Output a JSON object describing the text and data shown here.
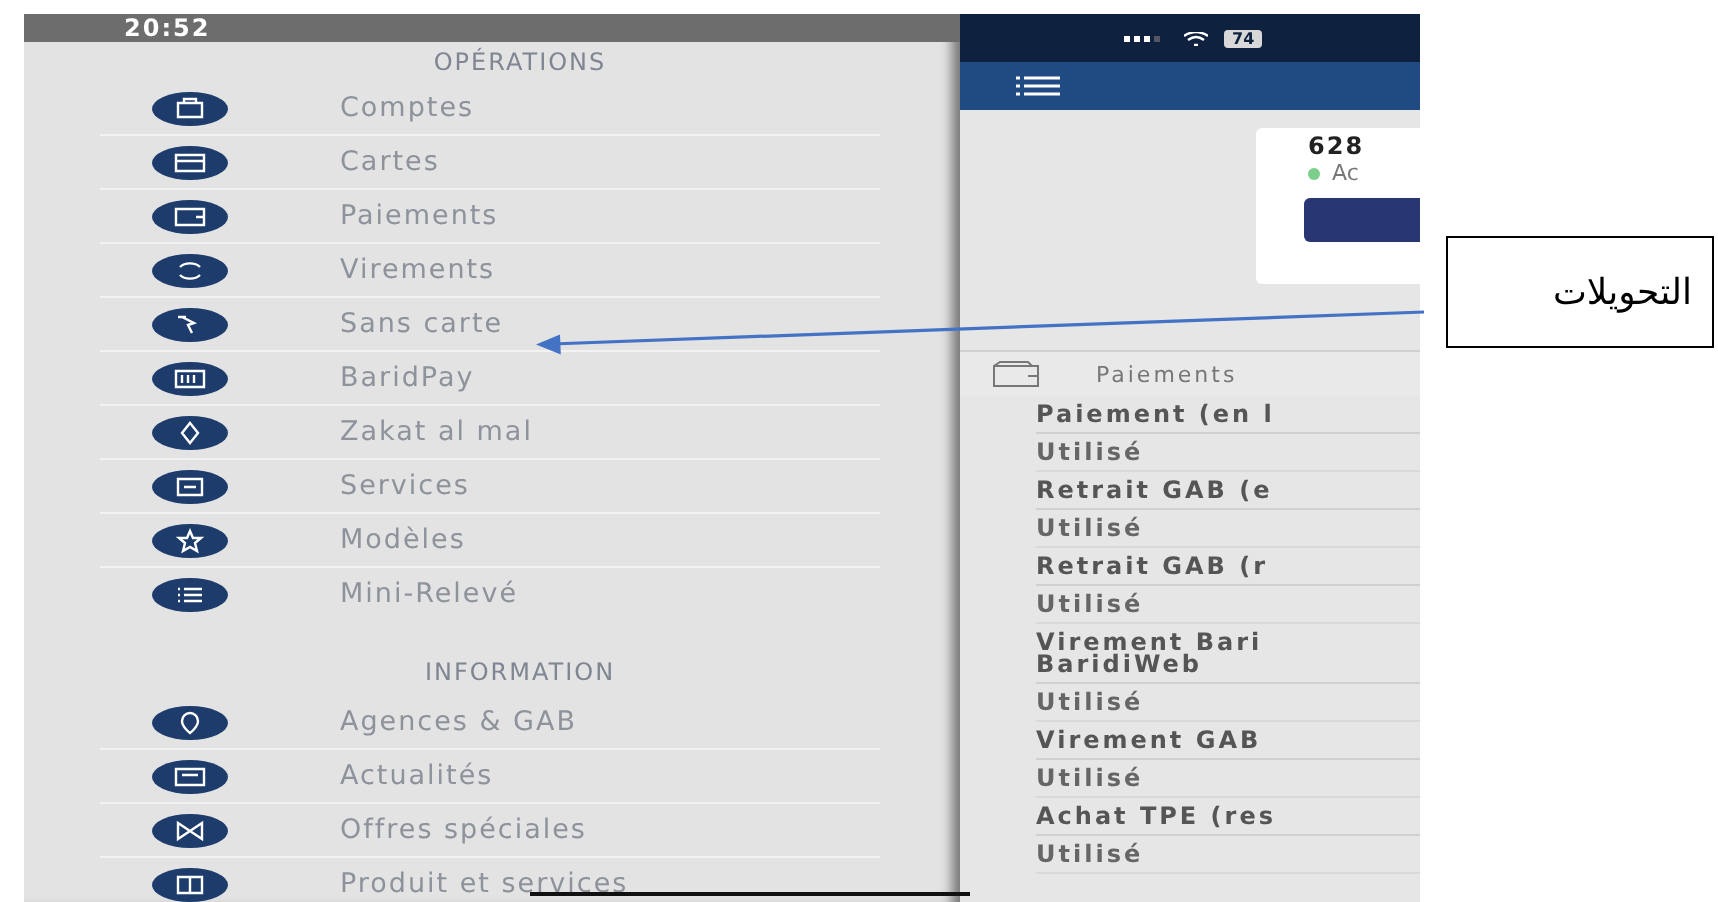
{
  "status_bar": {
    "time": "20:52",
    "battery": "74"
  },
  "drawer": {
    "sections": [
      {
        "title": "OPÉRATIONS",
        "items": [
          {
            "label": "Comptes"
          },
          {
            "label": "Cartes"
          },
          {
            "label": "Paiements"
          },
          {
            "label": "Virements"
          },
          {
            "label": "Sans carte"
          },
          {
            "label": "BaridPay"
          },
          {
            "label": "Zakat al mal"
          },
          {
            "label": "Services"
          },
          {
            "label": "Modèles"
          },
          {
            "label": "Mini-Relevé"
          }
        ]
      },
      {
        "title": "INFORMATION",
        "items": [
          {
            "label": "Agences & GAB"
          },
          {
            "label": "Actualités"
          },
          {
            "label": "Offres spéciales"
          },
          {
            "label": "Produit et services"
          }
        ]
      }
    ]
  },
  "account_card": {
    "number": "628",
    "status": "Ac"
  },
  "payments": {
    "title": "Paiements",
    "rows": [
      {
        "title": [
          "Paiement (en l"
        ],
        "status": "Utilisé"
      },
      {
        "title": [
          "Retrait GAB (e"
        ],
        "status": "Utilisé"
      },
      {
        "title": [
          "Retrait GAB (r"
        ],
        "status": "Utilisé"
      },
      {
        "title": [
          "Virement Bari",
          "BaridiWeb"
        ],
        "status": "Utilisé"
      },
      {
        "title": [
          "Virement GAB"
        ],
        "status": "Utilisé"
      },
      {
        "title": [
          "Achat TPE (res"
        ],
        "status": "Utilisé"
      }
    ]
  },
  "callout": {
    "text": "التحويلات"
  }
}
